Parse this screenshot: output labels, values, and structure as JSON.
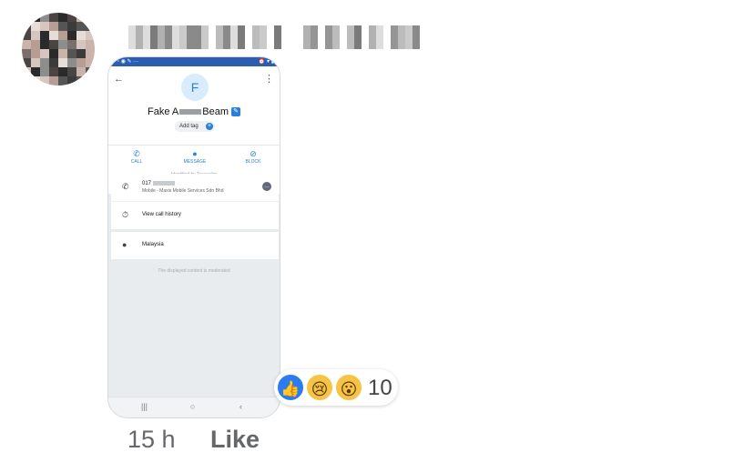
{
  "comment": {
    "time": "15 h",
    "like_label": "Like",
    "reaction_count": "10"
  },
  "screenshot": {
    "initial": "F",
    "name_prefix": "Fake A",
    "name_suffix": "Beam",
    "add_tag": "Add tag",
    "actions": [
      "CALL",
      "MESSAGE",
      "BLOCK"
    ],
    "identified": "Identified by Truecaller",
    "number_prefix": "017",
    "carrier": "Mobile - Maxis Mobile Services Sdn Bhd",
    "call_history": "View call history",
    "location": "Malaysia",
    "moderated": "The displayed content is moderated"
  },
  "colors": {
    "brand_blue": "#2a80d6",
    "like_blue": "#2b7bf3",
    "reaction_yellow": "#f6c344"
  }
}
